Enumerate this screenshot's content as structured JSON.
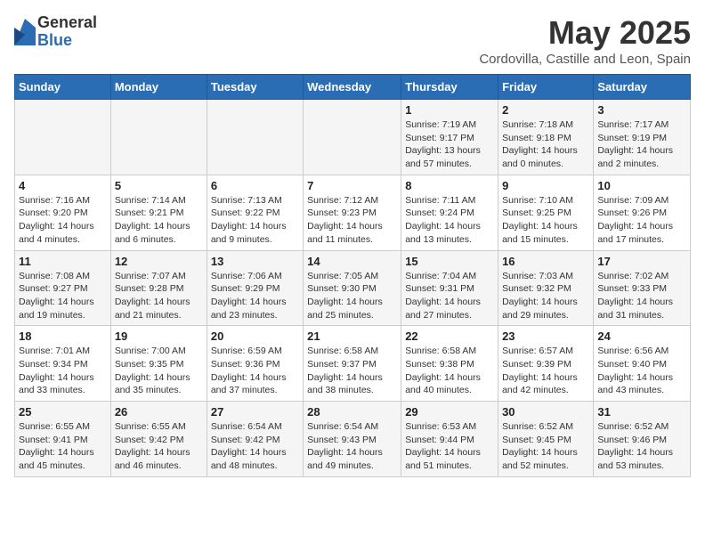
{
  "logo": {
    "general": "General",
    "blue": "Blue"
  },
  "title": "May 2025",
  "subtitle": "Cordovilla, Castille and Leon, Spain",
  "days_of_week": [
    "Sunday",
    "Monday",
    "Tuesday",
    "Wednesday",
    "Thursday",
    "Friday",
    "Saturday"
  ],
  "weeks": [
    [
      {
        "num": "",
        "info": ""
      },
      {
        "num": "",
        "info": ""
      },
      {
        "num": "",
        "info": ""
      },
      {
        "num": "",
        "info": ""
      },
      {
        "num": "1",
        "info": "Sunrise: 7:19 AM\nSunset: 9:17 PM\nDaylight: 13 hours and 57 minutes."
      },
      {
        "num": "2",
        "info": "Sunrise: 7:18 AM\nSunset: 9:18 PM\nDaylight: 14 hours and 0 minutes."
      },
      {
        "num": "3",
        "info": "Sunrise: 7:17 AM\nSunset: 9:19 PM\nDaylight: 14 hours and 2 minutes."
      }
    ],
    [
      {
        "num": "4",
        "info": "Sunrise: 7:16 AM\nSunset: 9:20 PM\nDaylight: 14 hours and 4 minutes."
      },
      {
        "num": "5",
        "info": "Sunrise: 7:14 AM\nSunset: 9:21 PM\nDaylight: 14 hours and 6 minutes."
      },
      {
        "num": "6",
        "info": "Sunrise: 7:13 AM\nSunset: 9:22 PM\nDaylight: 14 hours and 9 minutes."
      },
      {
        "num": "7",
        "info": "Sunrise: 7:12 AM\nSunset: 9:23 PM\nDaylight: 14 hours and 11 minutes."
      },
      {
        "num": "8",
        "info": "Sunrise: 7:11 AM\nSunset: 9:24 PM\nDaylight: 14 hours and 13 minutes."
      },
      {
        "num": "9",
        "info": "Sunrise: 7:10 AM\nSunset: 9:25 PM\nDaylight: 14 hours and 15 minutes."
      },
      {
        "num": "10",
        "info": "Sunrise: 7:09 AM\nSunset: 9:26 PM\nDaylight: 14 hours and 17 minutes."
      }
    ],
    [
      {
        "num": "11",
        "info": "Sunrise: 7:08 AM\nSunset: 9:27 PM\nDaylight: 14 hours and 19 minutes."
      },
      {
        "num": "12",
        "info": "Sunrise: 7:07 AM\nSunset: 9:28 PM\nDaylight: 14 hours and 21 minutes."
      },
      {
        "num": "13",
        "info": "Sunrise: 7:06 AM\nSunset: 9:29 PM\nDaylight: 14 hours and 23 minutes."
      },
      {
        "num": "14",
        "info": "Sunrise: 7:05 AM\nSunset: 9:30 PM\nDaylight: 14 hours and 25 minutes."
      },
      {
        "num": "15",
        "info": "Sunrise: 7:04 AM\nSunset: 9:31 PM\nDaylight: 14 hours and 27 minutes."
      },
      {
        "num": "16",
        "info": "Sunrise: 7:03 AM\nSunset: 9:32 PM\nDaylight: 14 hours and 29 minutes."
      },
      {
        "num": "17",
        "info": "Sunrise: 7:02 AM\nSunset: 9:33 PM\nDaylight: 14 hours and 31 minutes."
      }
    ],
    [
      {
        "num": "18",
        "info": "Sunrise: 7:01 AM\nSunset: 9:34 PM\nDaylight: 14 hours and 33 minutes."
      },
      {
        "num": "19",
        "info": "Sunrise: 7:00 AM\nSunset: 9:35 PM\nDaylight: 14 hours and 35 minutes."
      },
      {
        "num": "20",
        "info": "Sunrise: 6:59 AM\nSunset: 9:36 PM\nDaylight: 14 hours and 37 minutes."
      },
      {
        "num": "21",
        "info": "Sunrise: 6:58 AM\nSunset: 9:37 PM\nDaylight: 14 hours and 38 minutes."
      },
      {
        "num": "22",
        "info": "Sunrise: 6:58 AM\nSunset: 9:38 PM\nDaylight: 14 hours and 40 minutes."
      },
      {
        "num": "23",
        "info": "Sunrise: 6:57 AM\nSunset: 9:39 PM\nDaylight: 14 hours and 42 minutes."
      },
      {
        "num": "24",
        "info": "Sunrise: 6:56 AM\nSunset: 9:40 PM\nDaylight: 14 hours and 43 minutes."
      }
    ],
    [
      {
        "num": "25",
        "info": "Sunrise: 6:55 AM\nSunset: 9:41 PM\nDaylight: 14 hours and 45 minutes."
      },
      {
        "num": "26",
        "info": "Sunrise: 6:55 AM\nSunset: 9:42 PM\nDaylight: 14 hours and 46 minutes."
      },
      {
        "num": "27",
        "info": "Sunrise: 6:54 AM\nSunset: 9:42 PM\nDaylight: 14 hours and 48 minutes."
      },
      {
        "num": "28",
        "info": "Sunrise: 6:54 AM\nSunset: 9:43 PM\nDaylight: 14 hours and 49 minutes."
      },
      {
        "num": "29",
        "info": "Sunrise: 6:53 AM\nSunset: 9:44 PM\nDaylight: 14 hours and 51 minutes."
      },
      {
        "num": "30",
        "info": "Sunrise: 6:52 AM\nSunset: 9:45 PM\nDaylight: 14 hours and 52 minutes."
      },
      {
        "num": "31",
        "info": "Sunrise: 6:52 AM\nSunset: 9:46 PM\nDaylight: 14 hours and 53 minutes."
      }
    ]
  ]
}
